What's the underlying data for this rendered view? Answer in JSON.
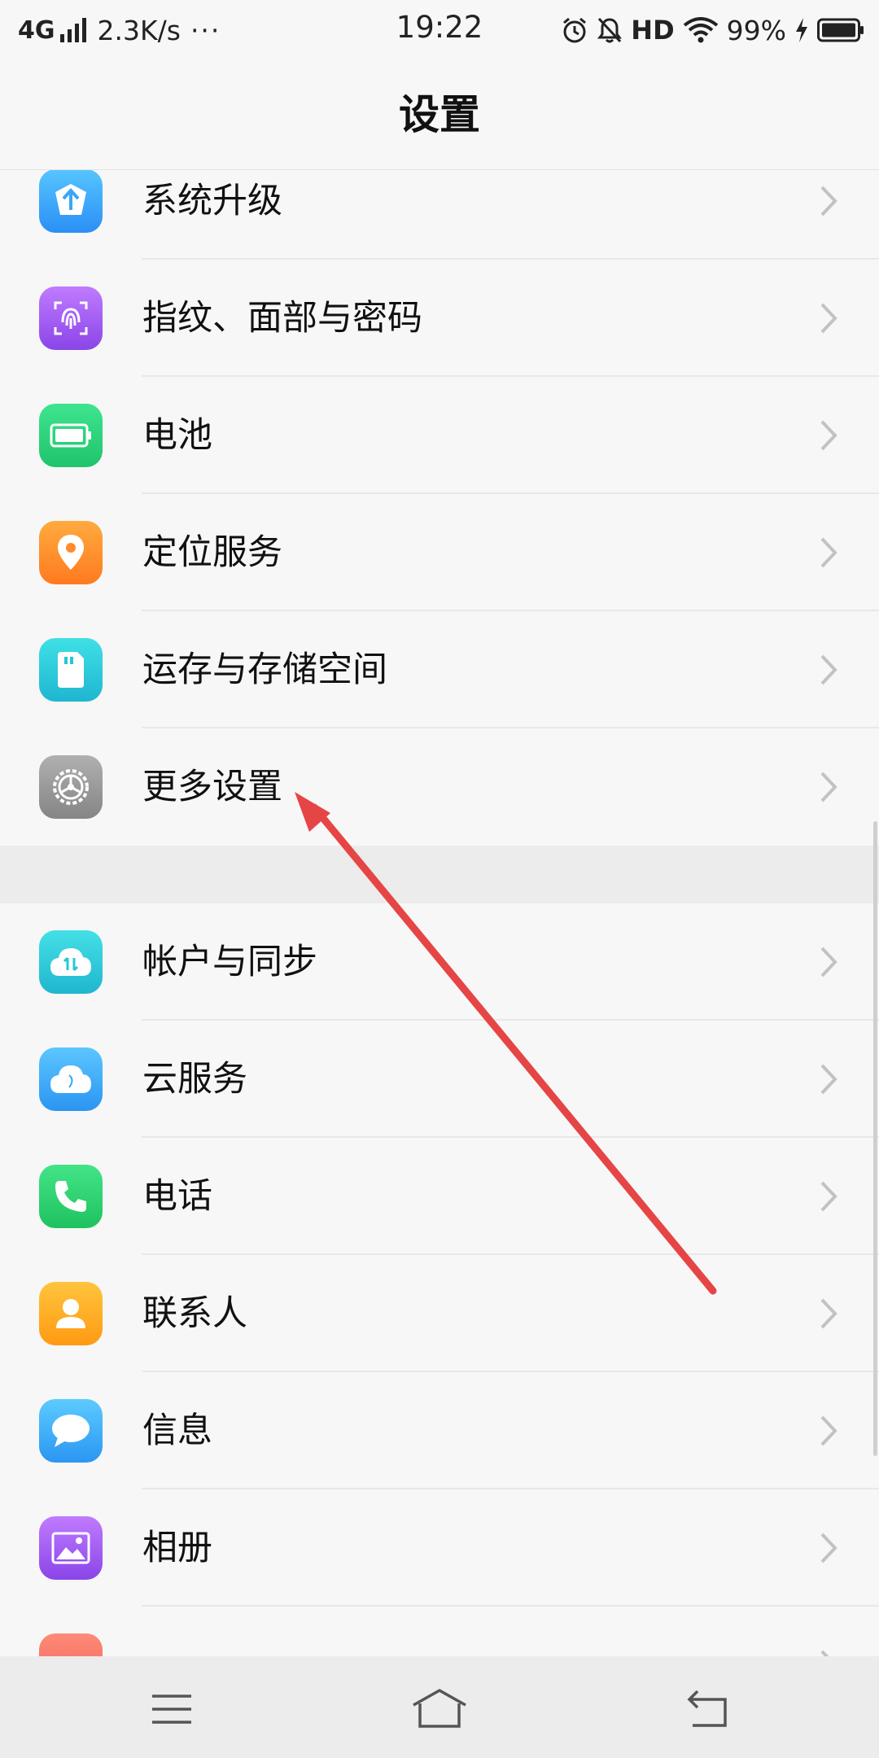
{
  "status_bar": {
    "network": "4G",
    "speed": "2.3K/s",
    "more": "···",
    "time": "19:22",
    "hd": "HD",
    "battery": "99%",
    "icons": [
      "signal-icon",
      "alarm-icon",
      "mute-bell-icon",
      "wifi-icon",
      "charging-icon",
      "battery-icon"
    ]
  },
  "header": {
    "title": "设置"
  },
  "settings": {
    "group1": [
      {
        "label": "系统升级",
        "icon": "system-upgrade-icon",
        "color": "#3aa6f7"
      },
      {
        "label": "指纹、面部与密码",
        "icon": "fingerprint-icon",
        "color": "#a55cf0"
      },
      {
        "label": "电池",
        "icon": "battery-icon",
        "color": "#2bd37f"
      },
      {
        "label": "定位服务",
        "icon": "location-icon",
        "color": "#ff8a2b"
      },
      {
        "label": "运存与存储空间",
        "icon": "storage-icon",
        "color": "#22c7d8"
      },
      {
        "label": "更多设置",
        "icon": "gear-icon",
        "color": "#9a9a9a"
      }
    ],
    "group2": [
      {
        "label": "帐户与同步",
        "icon": "account-sync-icon",
        "color": "#25c8d6"
      },
      {
        "label": "云服务",
        "icon": "cloud-icon",
        "color": "#34a9f5"
      },
      {
        "label": "电话",
        "icon": "phone-icon",
        "color": "#2cd46f"
      },
      {
        "label": "联系人",
        "icon": "contacts-icon",
        "color": "#ffae19"
      },
      {
        "label": "信息",
        "icon": "message-icon",
        "color": "#36a8f7"
      },
      {
        "label": "相册",
        "icon": "gallery-icon",
        "color": "#a55cf0"
      }
    ]
  },
  "annotation": {
    "color": "#e64545"
  },
  "nav": {
    "icons": [
      "menu-icon",
      "home-icon",
      "back-icon"
    ]
  }
}
